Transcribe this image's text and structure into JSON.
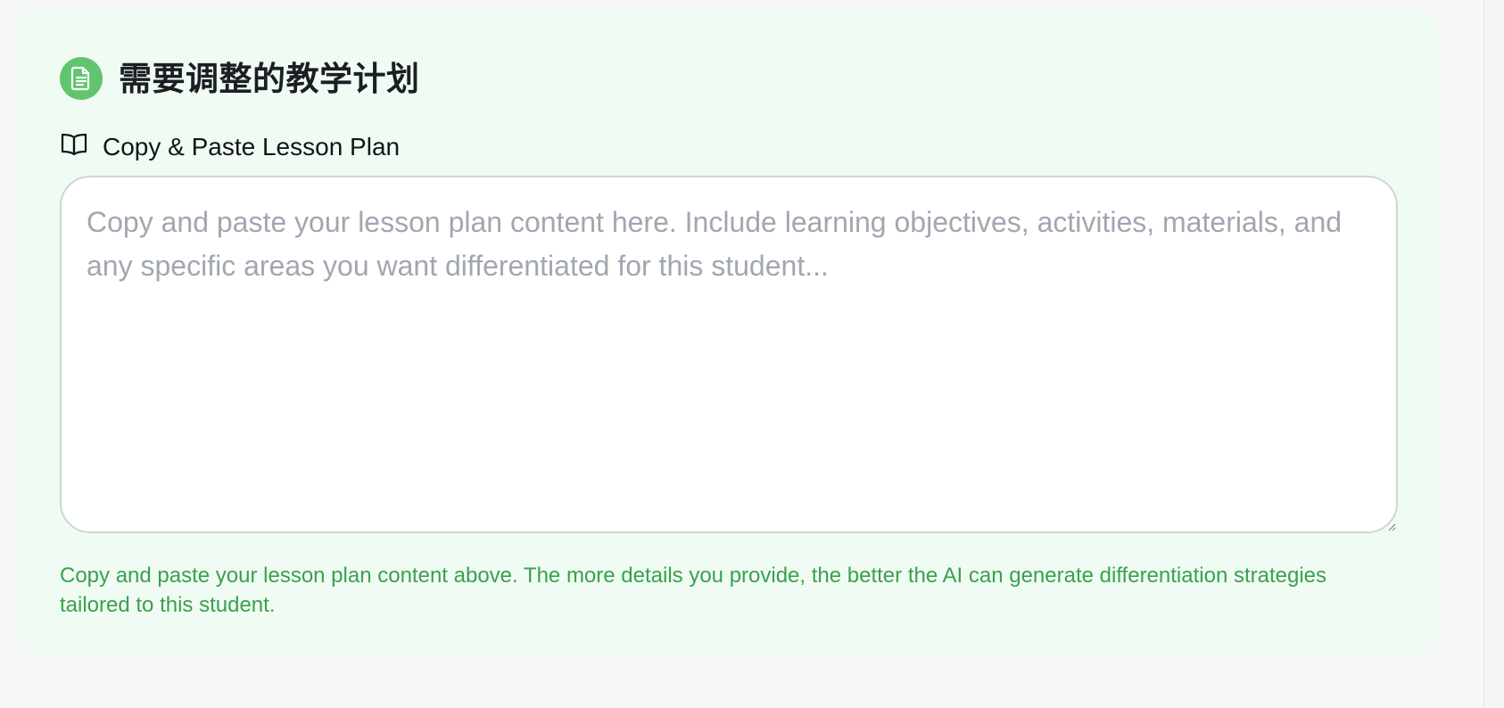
{
  "section": {
    "title": "需要调整的教学计划",
    "icon": "document-icon",
    "accent_color": "#61c56f"
  },
  "field": {
    "label": "Copy & Paste Lesson Plan",
    "label_icon": "open-book-icon",
    "value": "",
    "placeholder": "Copy and paste your lesson plan content here. Include learning objectives, activities, materials, and any specific areas you want differentiated for this student..."
  },
  "helper": {
    "text": "Copy and paste your lesson plan content above. The more details you provide, the better the AI can generate differentiation strategies tailored to this student.",
    "color": "#3aa14c"
  }
}
